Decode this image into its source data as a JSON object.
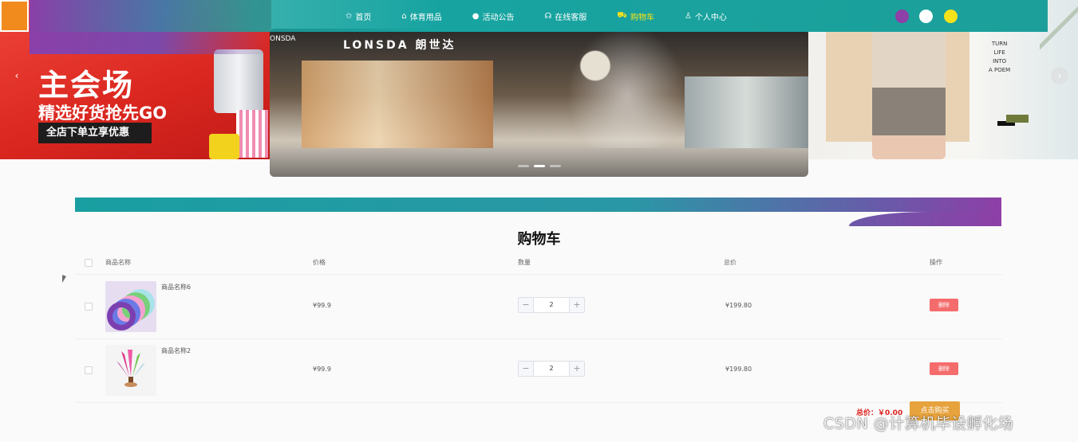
{
  "nav": {
    "items": [
      {
        "icon": "star-icon",
        "glyph": "✩",
        "label": "首页"
      },
      {
        "icon": "bag-icon",
        "glyph": "⌂",
        "label": "体育用品"
      },
      {
        "icon": "circle-icon",
        "glyph": "●",
        "label": "活动公告"
      },
      {
        "icon": "headset-icon",
        "glyph": "☊",
        "label": "在线客服"
      },
      {
        "icon": "cart-icon",
        "glyph": "⛟",
        "label": "购物车"
      },
      {
        "icon": "user-icon",
        "glyph": "♙",
        "label": "个人中心"
      }
    ],
    "active_index": 4,
    "theme_colors": [
      "#8e3fa8",
      "#ffffff",
      "#f5e21a"
    ]
  },
  "banner": {
    "left_headline": "主会场",
    "left_subline": "精选好货抢先GO",
    "left_promo": "全店下单立享优惠",
    "center_brand": "LONSDA 朗世达",
    "center_brand_small": "ONSDA",
    "right_words": "TURN\nLIFE\nINTO\nA POEM",
    "prev_arrow": "‹",
    "next_arrow": "›"
  },
  "cart": {
    "title": "购物车",
    "columns": {
      "name": "商品名称",
      "price": "价格",
      "qty": "数量",
      "total": "总价",
      "action": "操作"
    },
    "items": [
      {
        "name": "商品名称6",
        "price": "¥99.9",
        "qty": "2",
        "subtotal": "¥199.80",
        "delete_label": "删除",
        "thumb": "rings"
      },
      {
        "name": "商品名称2",
        "price": "¥99.9",
        "qty": "2",
        "subtotal": "¥199.80",
        "delete_label": "删除",
        "thumb": "shuttlecock"
      }
    ],
    "minus": "−",
    "plus": "+",
    "total_label": "总价：￥0.00",
    "buy_label": "点击购买"
  },
  "watermark": "CSDN @计算机毕设孵化场"
}
